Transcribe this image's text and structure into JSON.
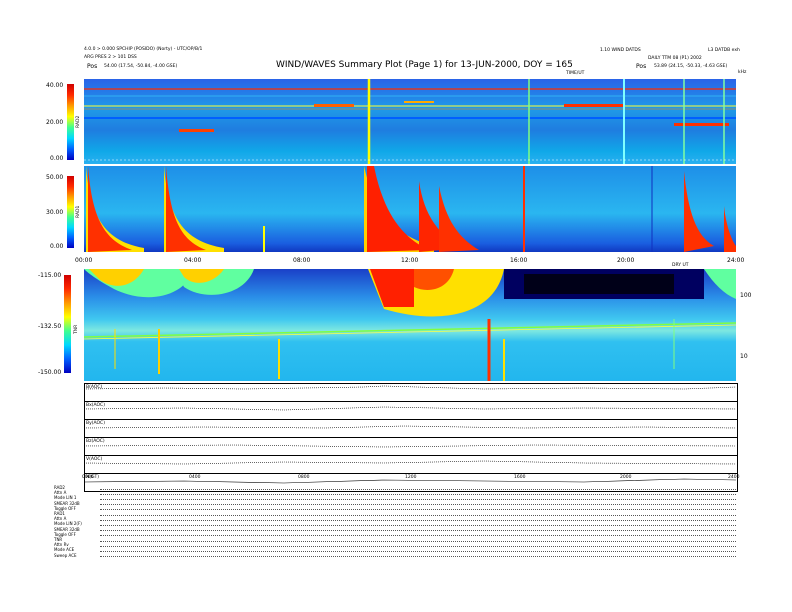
{
  "header": {
    "left_line1": "4.0.0 > 0.000 SPCHIP (POSIDO) (Norty) - UTC/OP/B/1",
    "left_line2": "ARG PRES 2 > 101 DSS",
    "left_line3_label": "Pos",
    "left_line3_value": "54.00 (17.54, -50.84, -4.00 GSE)",
    "title": "WIND/WAVES Summary Plot (Page 1) for 13-JUN-2000, DOY = 165",
    "right_line1a": "1.10 WIND DATDS",
    "right_line1b": "L3 DATDB exh",
    "right_line2": "DAILY TTM 08 (P1) 2002",
    "right_line3_label": "Pos",
    "right_line3_value": "53.89 (24.15, -50.33, -4.63 GSE)",
    "time_label_top": "TIME/UT",
    "time_label_mid": "DRY UT",
    "khz_label": "kHz"
  },
  "chart_data": {
    "type": "heatmap",
    "title": "WIND/WAVES Summary Plot (Page 1) for 13-JUN-2000, DOY = 165",
    "time_ticks": [
      "00:00",
      "04:00",
      "08:00",
      "12:00",
      "16:00",
      "20:00",
      "24:00"
    ],
    "panels": [
      {
        "name": "RAD2",
        "color_ticks": [
          "40.00",
          "20.00",
          "0.00"
        ]
      },
      {
        "name": "RAD1",
        "color_ticks": [
          "50.00",
          "30.00",
          "0.00"
        ]
      },
      {
        "name": "TNR",
        "color_ticks": [
          "-115.00",
          "-132.50",
          "-150.00"
        ],
        "freq_ticks": [
          "100",
          "10"
        ]
      }
    ],
    "line_panels": [
      "B(AOC)",
      "Bx(AOC)",
      "By(AOC)",
      "Bz(AOC)",
      "V(AOC)",
      "N(GT)"
    ],
    "bottom_time_ticks": [
      "0000",
      "0400",
      "0800",
      "1200",
      "1600",
      "2000",
      "2400"
    ],
    "colors": {
      "high": "#ff2000",
      "mid": "#ffff00",
      "low": "#0040ff",
      "background": "#1f9be8"
    }
  },
  "info_block": {
    "rad2": [
      "RAD2",
      "Attn  A",
      "Mode  LIN 1",
      "SMEAR 32dB",
      "Toggle  OFF"
    ],
    "rad1": [
      "RAD1",
      "Attn  A",
      "Mode  LIN 2(F)",
      "SMEAR 32dB",
      "Toggle  OFF"
    ],
    "tnr": [
      "TNR",
      "Attn  Rv",
      "Mode  ACE",
      "Sweep  ACE"
    ]
  }
}
